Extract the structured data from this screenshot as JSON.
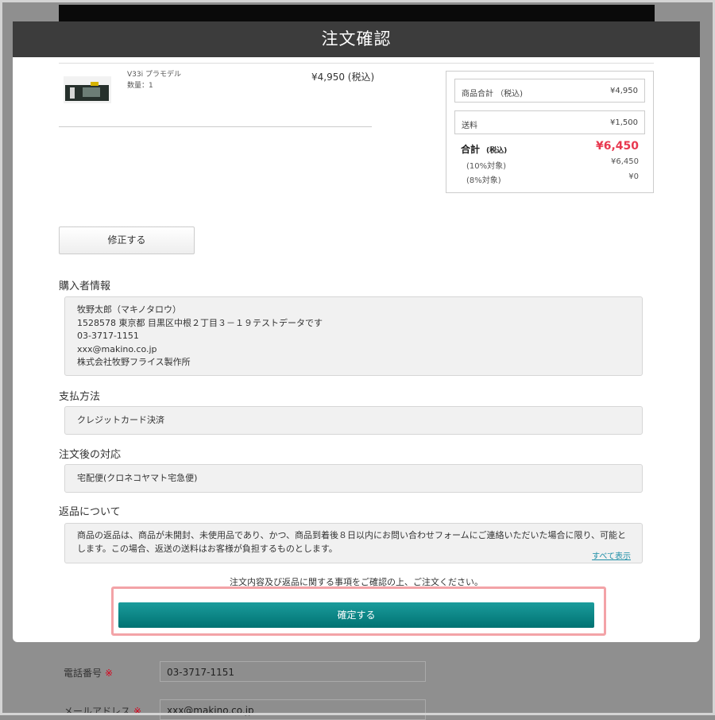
{
  "background": {
    "phone_label": "電話番号",
    "phone_value": "03-3717-1151",
    "email_label": "メールアドレス",
    "email_value": "xxx@makino.co.jp",
    "required_mark": "※"
  },
  "modal": {
    "title": "注文確認",
    "item": {
      "name": "V33i プラモデル",
      "quantity": "数量：1",
      "price": "¥4,950 (税込)"
    },
    "summary": {
      "subtotal_label": "商品合計 （税込)",
      "subtotal_value": "¥4,950",
      "shipping_label": "送料",
      "shipping_value": "¥1,500",
      "total_label": "合計",
      "total_tax_note": "(税込)",
      "total_value": "¥6,450",
      "tax10_label": "(10%対象)",
      "tax10_value": "¥6,450",
      "tax8_label": "(8%対象)",
      "tax8_value": "¥0"
    },
    "modify_button": "修正する",
    "buyer": {
      "title": "購入者情報",
      "name": "牧野太郎（マキノタロウ）",
      "address": "1528578 東京都 目黒区中根２丁目３－１９テストデータです",
      "phone": "03-3717-1151",
      "email": "xxx@makino.co.jp",
      "company": "株式会社牧野フライス製作所"
    },
    "payment": {
      "title": "支払方法",
      "value": "クレジットカード決済"
    },
    "after_order": {
      "title": "注文後の対応",
      "value": "宅配便(クロネコヤマト宅急便)"
    },
    "returns": {
      "title": "返品について",
      "line1": "商品の返品は、商品が未開封、未使用品であり、かつ、商品到着後８日以内にお問い合わせフォームにご連絡いただいた場合に限り、可能と",
      "line2": "します。この場合、返送の送料はお客様が負担するものとします。",
      "show_all": "すべて表示"
    },
    "confirm_note": "注文内容及び返品に関する事項をご確認の上、ご注文ください。",
    "confirm_button": "確定する"
  },
  "colors": {
    "header_bg": "#3c3c3c",
    "total_price": "#e8384f",
    "confirm_button": "#007272",
    "highlight_border": "#f3a3a7",
    "link": "#1e8fa7"
  }
}
